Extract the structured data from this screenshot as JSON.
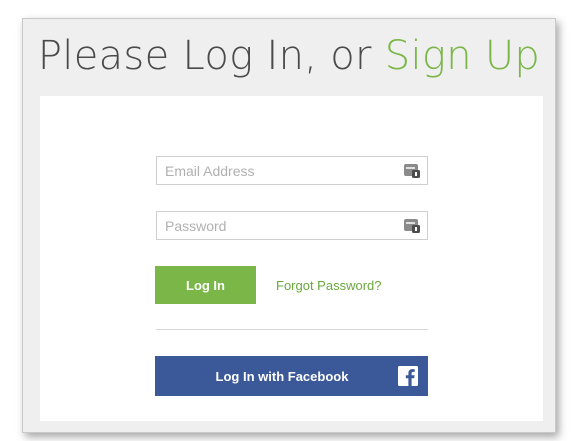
{
  "header": {
    "title_prefix": "Please Log In, or ",
    "title_link": "Sign Up"
  },
  "form": {
    "email": {
      "placeholder": "Email Address",
      "value": ""
    },
    "password": {
      "placeholder": "Password",
      "value": ""
    },
    "login_label": "Log In",
    "forgot_label": "Forgot Password?",
    "facebook_label": "Log In with Facebook"
  },
  "icons": {
    "field_icon": "password-manager-icon",
    "facebook_icon": "facebook-icon"
  },
  "colors": {
    "accent": "#7ab648",
    "facebook": "#3b5998",
    "card_bg": "#efefef"
  }
}
